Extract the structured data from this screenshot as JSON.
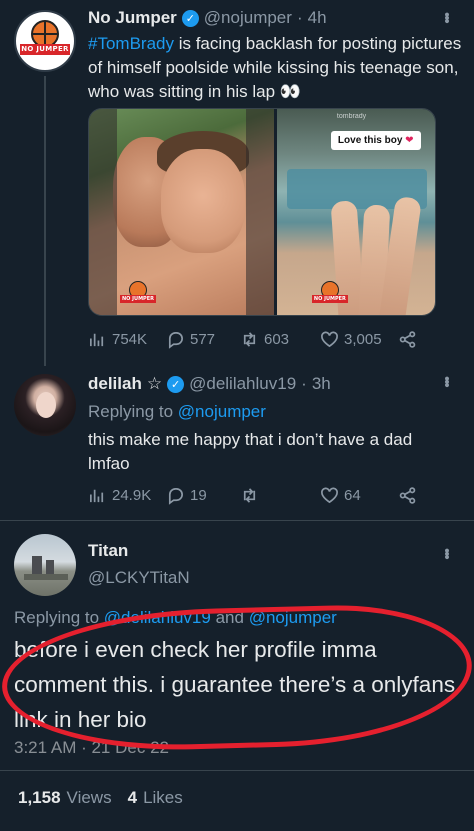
{
  "tweets": [
    {
      "display_name": "No Jumper",
      "handle": "@nojumper",
      "time": "4h",
      "avatar_text": "NO JUMPER",
      "hashtag": "#TomBrady",
      "text": " is facing backlash for posting pictures of himself poolside while kissing his teenage son, who was sitting in his lap",
      "emoji": "👀",
      "media": {
        "story_tag": "Love this boy",
        "watermark": "NO JUMPER",
        "top_caption": "tombrady"
      },
      "actions": {
        "views": "754K",
        "replies": "577",
        "retweets": "603",
        "likes": "3,005"
      }
    },
    {
      "display_name": "delilah",
      "name_suffix": "☆",
      "handle": "@delilahluv19",
      "time": "3h",
      "replying_label": "Replying to",
      "replying_to": "@nojumper",
      "text": "this make me happy that i don’t have a dad lmfao",
      "actions": {
        "views": "24.9K",
        "replies": "19",
        "retweets": "",
        "likes": "64"
      }
    },
    {
      "display_name": "Titan",
      "handle": "@LCKYTitaN",
      "replying_label": "Replying to",
      "replying_to_1": "@delilahluv19",
      "replying_and": "and",
      "replying_to_2": "@nojumper",
      "text": "before i even check her profile imma comment this. i guarantee there’s a onlyfans link in her bio",
      "timestamp": "3:21 AM · 21 Dec 22",
      "views_count": "1,158",
      "views_label": "Views",
      "likes_count": "4",
      "likes_label": "Likes"
    }
  ],
  "colors": {
    "background": "#15202b",
    "link": "#1d9bf0",
    "muted": "#8b98a5",
    "annotation_circle": "#e5202e"
  }
}
